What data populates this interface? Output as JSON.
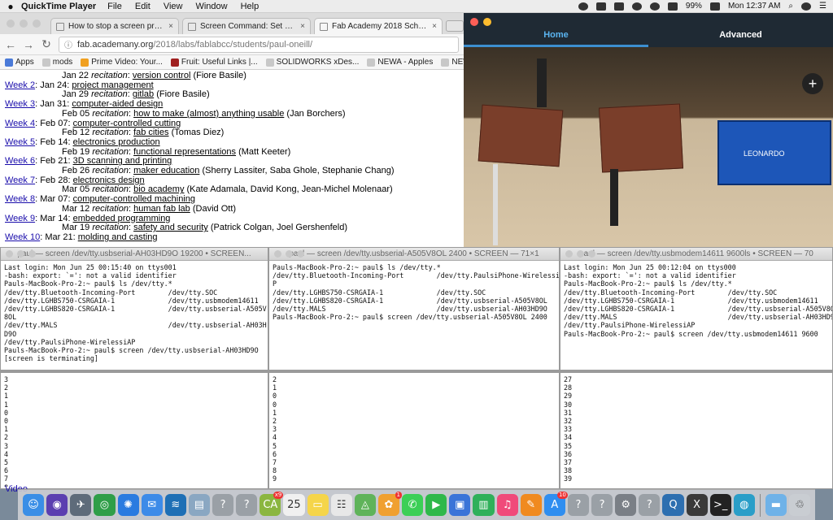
{
  "menubar": {
    "app_name": "QuickTime Player",
    "menus": [
      "File",
      "Edit",
      "View",
      "Window",
      "Help"
    ],
    "battery": "99%",
    "clock": "Mon 12:37 AM"
  },
  "browser": {
    "tabs": [
      {
        "title": "How to stop a screen process"
      },
      {
        "title": "Screen Command: Set Baud Ra"
      },
      {
        "title": "Fab Academy 2018 Schedule"
      }
    ],
    "url_host": "fab.academany.org",
    "url_path": "/2018/labs/fablabcc/students/paul-oneill/",
    "bookmarks": [
      "Apps",
      "mods",
      "Prime Video: Your...",
      "Fruit: Useful Links |...",
      "SOLIDWORKS xDes...",
      "NEWA - Apples",
      "NEWA - W"
    ],
    "schedule": [
      {
        "indent": true,
        "date": "Jan 22",
        "kind": "recitation",
        "topic": "version control",
        "who": "(Fiore Basile)"
      },
      {
        "indent": false,
        "week": "Week 2",
        "date": "Jan 24:",
        "topic": "project management"
      },
      {
        "indent": true,
        "date": "Jan 29",
        "kind": "recitation",
        "topic": "gitlab",
        "who": "(Fiore Basile)"
      },
      {
        "indent": false,
        "week": "Week 3",
        "date": "Jan 31:",
        "topic": "computer-aided design"
      },
      {
        "indent": true,
        "date": "Feb 05",
        "kind": "recitation",
        "topic": "how to make (almost) anything usable",
        "who": "(Jan Borchers)"
      },
      {
        "indent": false,
        "week": "Week 4",
        "date": "Feb 07:",
        "topic": "computer-controlled cutting"
      },
      {
        "indent": true,
        "date": "Feb 12",
        "kind": "recitation",
        "topic": "fab cities",
        "who": "(Tomas Diez)"
      },
      {
        "indent": false,
        "week": "Week 5",
        "date": "Feb 14:",
        "topic": "electronics production"
      },
      {
        "indent": true,
        "date": "Feb 19",
        "kind": "recitation",
        "topic": "functional representations",
        "who": "(Matt Keeter)"
      },
      {
        "indent": false,
        "week": "Week 6",
        "date": "Feb 21:",
        "topic": "3D scanning and printing"
      },
      {
        "indent": true,
        "date": "Feb 26",
        "kind": "recitation",
        "topic": "maker education",
        "who": "(Sherry Lassiter, Saba Ghole, Stephanie Chang)"
      },
      {
        "indent": false,
        "week": "Week 7",
        "date": "Feb 28:",
        "topic": "electronics design"
      },
      {
        "indent": true,
        "date": "Mar 05",
        "kind": "recitation",
        "topic": "bio academy",
        "who": "(Kate Adamala, David Kong, Jean-Michel Molenaar)"
      },
      {
        "indent": false,
        "week": "Week 8",
        "date": "Mar 07:",
        "topic": "computer-controlled machining"
      },
      {
        "indent": true,
        "date": "Mar 12",
        "kind": "recitation",
        "topic": "human fab lab",
        "who": "(David Ott)"
      },
      {
        "indent": false,
        "week": "Week 9",
        "date": "Mar 14:",
        "topic": "embedded programming"
      },
      {
        "indent": true,
        "date": "Mar 19",
        "kind": "recitation",
        "topic": "safety and security",
        "who": "(Patrick Colgan, Joel Gershenfeld)"
      },
      {
        "indent": false,
        "week": "Week 10",
        "date": "Mar 21:",
        "topic": "molding and casting"
      }
    ],
    "video_link": "Video"
  },
  "video_app": {
    "tab_home": "Home",
    "tab_advanced": "Advanced",
    "board_label": "LEONARDO",
    "colors": {
      "accent": "#3c8fd0",
      "tab_active": "#5ab4f0"
    }
  },
  "terminals": [
    {
      "title": "paul — screen /dev/tty.usbserial-AH03HD9O 19200 • SCREEN...",
      "top": "Last login: Mon Jun 25 00:15:40 on ttys001\n-bash: export: `=': not a valid identifier\nPauls-MacBook-Pro-2:~ paul$ ls /dev/tty.*\n/dev/tty.Bluetooth-Incoming-Port        /dev/tty.SOC\n/dev/tty.LGHBS750-CSRGAIA-1             /dev/tty.usbmodem14611\n/dev/tty.LGHBS820-CSRGAIA-1             /dev/tty.usbserial-A505V\n8OL\n/dev/tty.MALS                           /dev/tty.usbserial-AH03H\nD9O\n/dev/tty.PaulsiPhone-WirelessiAP\nPauls-MacBook-Pro-2:~ paul$ screen /dev/tty.usbserial-AH03HD9O\n[screen is terminating]",
      "bottom": "3\n2\n1\n1\n0\n0\n1\n2\n3\n4\n5\n6\n7\n8\n9"
    },
    {
      "title": "paul — screen /dev/tty.usbserial-A505V8OL 2400 • SCREEN — 71×1",
      "top": "Pauls-MacBook-Pro-2:~ paul$ ls /dev/tty.*\n/dev/tty.Bluetooth-Incoming-Port        /dev/tty.PaulsiPhone-WirelessiA\nP\n/dev/tty.LGHBS750-CSRGAIA-1             /dev/tty.SOC\n/dev/tty.LGHBS820-CSRGAIA-1             /dev/tty.usbserial-A505V8OL\n/dev/tty.MALS                           /dev/tty.usbserial-AH03HD9O\nPauls-MacBook-Pro-2:~ paul$ screen /dev/tty.usbserial-A505V8OL 2400",
      "bottom": "2\n1\n0\n0\n1\n2\n3\n4\n5\n6\n7\n8\n9"
    },
    {
      "title": "paul — screen /dev/tty.usbmodem14611 9600ls • SCREEN — 70",
      "top": "Last login: Mon Jun 25 00:12:04 on ttys000\n-bash: export: `=': not a valid identifier\nPauls-MacBook-Pro-2:~ paul$ ls /dev/tty.*\n/dev/tty.Bluetooth-Incoming-Port        /dev/tty.SOC\n/dev/tty.LGHBS750-CSRGAIA-1             /dev/tty.usbmodem14611\n/dev/tty.LGHBS820-CSRGAIA-1             /dev/tty.usbserial-A505V8O\n/dev/tty.MALS                           /dev/tty.usbserial-AH03HD9\n/dev/tty.PaulsiPhone-WirelessiAP\nPauls-MacBook-Pro-2:~ paul$ screen /dev/tty.usbmodem14611 9600",
      "bottom": "27\n28\n29\n30\n31\n32\n33\n34\n35\n36\n37\n38\n39"
    }
  ],
  "dock": [
    {
      "name": "finder-icon",
      "glyph": "☺",
      "color": "#3a8ee6"
    },
    {
      "name": "siri-icon",
      "glyph": "◉",
      "color": "#5b3fb0"
    },
    {
      "name": "launchpad-icon",
      "glyph": "✈",
      "color": "#5e6b7a"
    },
    {
      "name": "chrome-icon",
      "glyph": "◎",
      "color": "#2f9e48"
    },
    {
      "name": "safari-icon",
      "glyph": "✺",
      "color": "#2a7be0"
    },
    {
      "name": "mail-icon",
      "glyph": "✉",
      "color": "#3d8be8"
    },
    {
      "name": "eagle-icon",
      "glyph": "≋",
      "color": "#1e6fb5"
    },
    {
      "name": "preview-icon",
      "glyph": "▤",
      "color": "#8aa7c2"
    },
    {
      "name": "unknown-app-icon",
      "glyph": "?",
      "color": "#9aa0a6"
    },
    {
      "name": "unknown-app-icon",
      "glyph": "?",
      "color": "#9aa0a6"
    },
    {
      "name": "calendar-app-icon",
      "glyph": "CA",
      "color": "#8bb640",
      "badge": "x9"
    },
    {
      "name": "calendar-icon",
      "glyph": "25",
      "color": "#f0f0f0"
    },
    {
      "name": "notes-icon",
      "glyph": "▭",
      "color": "#f5d54a"
    },
    {
      "name": "reminders-icon",
      "glyph": "☷",
      "color": "#e8e8e8"
    },
    {
      "name": "maps-icon",
      "glyph": "◬",
      "color": "#5fb35a"
    },
    {
      "name": "photos-icon",
      "glyph": "✿",
      "color": "#f0a030",
      "badge": "1"
    },
    {
      "name": "messages-icon",
      "glyph": "✆",
      "color": "#3ccf56"
    },
    {
      "name": "facetime-icon",
      "glyph": "▶",
      "color": "#2fb84a"
    },
    {
      "name": "keynote-icon",
      "glyph": "▣",
      "color": "#3a74d8"
    },
    {
      "name": "numbers-icon",
      "glyph": "▥",
      "color": "#2fb05a"
    },
    {
      "name": "music-icon",
      "glyph": "♫",
      "color": "#f04a7a"
    },
    {
      "name": "books-icon",
      "glyph": "✎",
      "color": "#f08a20"
    },
    {
      "name": "appstore-icon",
      "glyph": "A",
      "color": "#2f8ef0",
      "badge": "10"
    },
    {
      "name": "unknown-app-icon",
      "glyph": "?",
      "color": "#9aa0a6"
    },
    {
      "name": "unknown-app-icon",
      "glyph": "?",
      "color": "#9aa0a6"
    },
    {
      "name": "system-preferences-icon",
      "glyph": "⚙",
      "color": "#7a7f86"
    },
    {
      "name": "unknown-app-icon",
      "glyph": "?",
      "color": "#9aa0a6"
    },
    {
      "name": "quicktime-icon",
      "glyph": "Q",
      "color": "#2d6fb0"
    },
    {
      "name": "x11-icon",
      "glyph": "X",
      "color": "#3a3a3a"
    },
    {
      "name": "terminal-icon",
      "glyph": ">_",
      "color": "#222222"
    },
    {
      "name": "network-icon",
      "glyph": "◍",
      "color": "#2a9ec8"
    },
    {
      "name": "folder-icon",
      "glyph": "▬",
      "color": "#6fb2e8"
    },
    {
      "name": "trash-icon",
      "glyph": "♲",
      "color": "#c9cdd2"
    }
  ]
}
